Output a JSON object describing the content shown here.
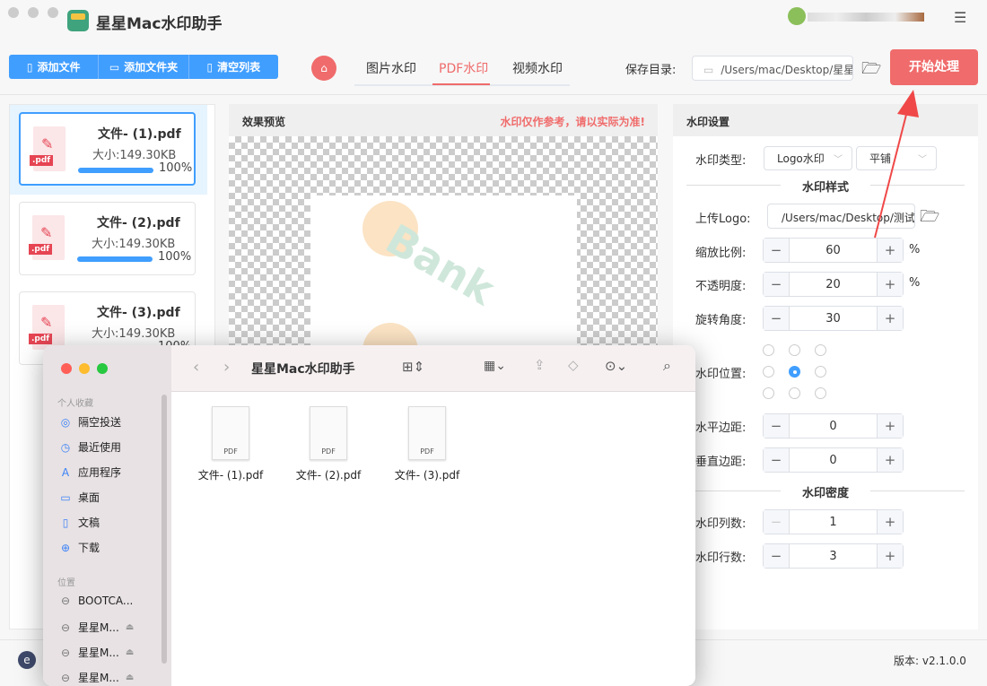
{
  "app": {
    "title": "星星Mac水印助手",
    "accent": "#409eff",
    "danger": "#f06b6b"
  },
  "toolbar": {
    "add_file": "添加文件",
    "add_folder": "添加文件夹",
    "clear_list": "清空列表",
    "save_dir_label": "保存目录:",
    "save_dir_value": "/Users/mac/Desktop/星星",
    "start": "开始处理"
  },
  "tabs": [
    {
      "label": "图片水印"
    },
    {
      "label": "PDF水印",
      "active": true
    },
    {
      "label": "视频水印"
    }
  ],
  "files": [
    {
      "name": "文件- (1).pdf",
      "size": "大小:149.30KB",
      "progress": "100%"
    },
    {
      "name": "文件- (2).pdf",
      "size": "大小:149.30KB",
      "progress": "100%"
    },
    {
      "name": "文件- (3).pdf",
      "size": "大小:149.30KB",
      "progress": "100%"
    }
  ],
  "preview": {
    "title": "效果预览",
    "notice": "水印仅作参考，请以实际为准!",
    "logo_text": "Bank"
  },
  "settings": {
    "title": "水印设置",
    "type_label": "水印类型:",
    "type_value": "Logo水印",
    "layout_value": "平铺",
    "style_section": "水印样式",
    "logo_label": "上传Logo:",
    "logo_path": "/Users/mac/Desktop/测试",
    "scale_label": "缩放比例:",
    "scale": "60",
    "scale_unit": "%",
    "opacity_label": "不透明度:",
    "opacity": "20",
    "opacity_unit": "%",
    "rotation_label": "旋转角度:",
    "rotation": "30",
    "position_label": "水印位置:",
    "position_selected": "center",
    "hmargin_label": "水平边距:",
    "hmargin": "0",
    "vmargin_label": "垂直边距:",
    "vmargin": "0",
    "density_section": "水印密度",
    "cols_label": "水印列数:",
    "cols": "1",
    "rows_label": "水印行数:",
    "rows": "3"
  },
  "footer": {
    "version": "版本: v2.1.0.0"
  },
  "finder": {
    "title": "星星Mac水印助手",
    "favorites_head": "个人收藏",
    "favorites": [
      {
        "label": "隔空投送",
        "icon": "airdrop-icon"
      },
      {
        "label": "最近使用",
        "icon": "clock-icon"
      },
      {
        "label": "应用程序",
        "icon": "apps-icon"
      },
      {
        "label": "桌面",
        "icon": "desktop-icon"
      },
      {
        "label": "文稿",
        "icon": "document-icon"
      },
      {
        "label": "下载",
        "icon": "download-icon"
      }
    ],
    "locations_head": "位置",
    "locations": [
      {
        "label": "BOOTCA..."
      },
      {
        "label": "星星M..."
      },
      {
        "label": "星星M..."
      },
      {
        "label": "星星M..."
      }
    ],
    "files": [
      {
        "name": "文件- (1).pdf",
        "type": "PDF"
      },
      {
        "name": "文件- (2).pdf",
        "type": "PDF"
      },
      {
        "name": "文件- (3).pdf",
        "type": "PDF"
      }
    ]
  }
}
